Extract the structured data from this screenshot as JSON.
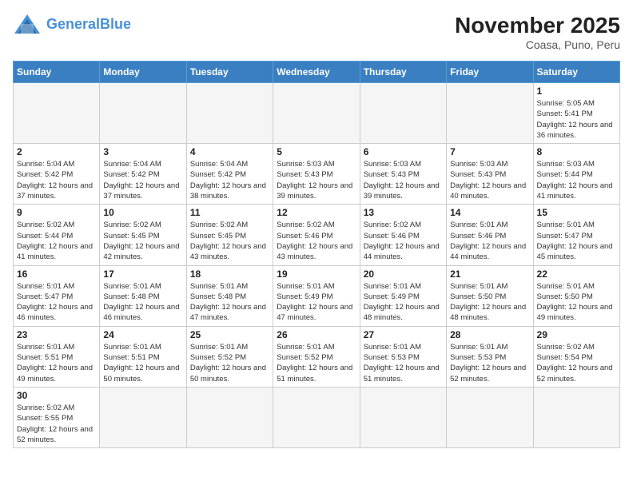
{
  "header": {
    "logo_general": "General",
    "logo_blue": "Blue",
    "month_year": "November 2025",
    "location": "Coasa, Puno, Peru"
  },
  "weekdays": [
    "Sunday",
    "Monday",
    "Tuesday",
    "Wednesday",
    "Thursday",
    "Friday",
    "Saturday"
  ],
  "weeks": [
    [
      {
        "day": "",
        "info": ""
      },
      {
        "day": "",
        "info": ""
      },
      {
        "day": "",
        "info": ""
      },
      {
        "day": "",
        "info": ""
      },
      {
        "day": "",
        "info": ""
      },
      {
        "day": "",
        "info": ""
      },
      {
        "day": "1",
        "info": "Sunrise: 5:05 AM\nSunset: 5:41 PM\nDaylight: 12 hours\nand 36 minutes."
      }
    ],
    [
      {
        "day": "2",
        "info": "Sunrise: 5:04 AM\nSunset: 5:42 PM\nDaylight: 12 hours\nand 37 minutes."
      },
      {
        "day": "3",
        "info": "Sunrise: 5:04 AM\nSunset: 5:42 PM\nDaylight: 12 hours\nand 37 minutes."
      },
      {
        "day": "4",
        "info": "Sunrise: 5:04 AM\nSunset: 5:42 PM\nDaylight: 12 hours\nand 38 minutes."
      },
      {
        "day": "5",
        "info": "Sunrise: 5:03 AM\nSunset: 5:43 PM\nDaylight: 12 hours\nand 39 minutes."
      },
      {
        "day": "6",
        "info": "Sunrise: 5:03 AM\nSunset: 5:43 PM\nDaylight: 12 hours\nand 39 minutes."
      },
      {
        "day": "7",
        "info": "Sunrise: 5:03 AM\nSunset: 5:43 PM\nDaylight: 12 hours\nand 40 minutes."
      },
      {
        "day": "8",
        "info": "Sunrise: 5:03 AM\nSunset: 5:44 PM\nDaylight: 12 hours\nand 41 minutes."
      }
    ],
    [
      {
        "day": "9",
        "info": "Sunrise: 5:02 AM\nSunset: 5:44 PM\nDaylight: 12 hours\nand 41 minutes."
      },
      {
        "day": "10",
        "info": "Sunrise: 5:02 AM\nSunset: 5:45 PM\nDaylight: 12 hours\nand 42 minutes."
      },
      {
        "day": "11",
        "info": "Sunrise: 5:02 AM\nSunset: 5:45 PM\nDaylight: 12 hours\nand 43 minutes."
      },
      {
        "day": "12",
        "info": "Sunrise: 5:02 AM\nSunset: 5:46 PM\nDaylight: 12 hours\nand 43 minutes."
      },
      {
        "day": "13",
        "info": "Sunrise: 5:02 AM\nSunset: 5:46 PM\nDaylight: 12 hours\nand 44 minutes."
      },
      {
        "day": "14",
        "info": "Sunrise: 5:01 AM\nSunset: 5:46 PM\nDaylight: 12 hours\nand 44 minutes."
      },
      {
        "day": "15",
        "info": "Sunrise: 5:01 AM\nSunset: 5:47 PM\nDaylight: 12 hours\nand 45 minutes."
      }
    ],
    [
      {
        "day": "16",
        "info": "Sunrise: 5:01 AM\nSunset: 5:47 PM\nDaylight: 12 hours\nand 46 minutes."
      },
      {
        "day": "17",
        "info": "Sunrise: 5:01 AM\nSunset: 5:48 PM\nDaylight: 12 hours\nand 46 minutes."
      },
      {
        "day": "18",
        "info": "Sunrise: 5:01 AM\nSunset: 5:48 PM\nDaylight: 12 hours\nand 47 minutes."
      },
      {
        "day": "19",
        "info": "Sunrise: 5:01 AM\nSunset: 5:49 PM\nDaylight: 12 hours\nand 47 minutes."
      },
      {
        "day": "20",
        "info": "Sunrise: 5:01 AM\nSunset: 5:49 PM\nDaylight: 12 hours\nand 48 minutes."
      },
      {
        "day": "21",
        "info": "Sunrise: 5:01 AM\nSunset: 5:50 PM\nDaylight: 12 hours\nand 48 minutes."
      },
      {
        "day": "22",
        "info": "Sunrise: 5:01 AM\nSunset: 5:50 PM\nDaylight: 12 hours\nand 49 minutes."
      }
    ],
    [
      {
        "day": "23",
        "info": "Sunrise: 5:01 AM\nSunset: 5:51 PM\nDaylight: 12 hours\nand 49 minutes."
      },
      {
        "day": "24",
        "info": "Sunrise: 5:01 AM\nSunset: 5:51 PM\nDaylight: 12 hours\nand 50 minutes."
      },
      {
        "day": "25",
        "info": "Sunrise: 5:01 AM\nSunset: 5:52 PM\nDaylight: 12 hours\nand 50 minutes."
      },
      {
        "day": "26",
        "info": "Sunrise: 5:01 AM\nSunset: 5:52 PM\nDaylight: 12 hours\nand 51 minutes."
      },
      {
        "day": "27",
        "info": "Sunrise: 5:01 AM\nSunset: 5:53 PM\nDaylight: 12 hours\nand 51 minutes."
      },
      {
        "day": "28",
        "info": "Sunrise: 5:01 AM\nSunset: 5:53 PM\nDaylight: 12 hours\nand 52 minutes."
      },
      {
        "day": "29",
        "info": "Sunrise: 5:02 AM\nSunset: 5:54 PM\nDaylight: 12 hours\nand 52 minutes."
      }
    ],
    [
      {
        "day": "30",
        "info": "Sunrise: 5:02 AM\nSunset: 5:55 PM\nDaylight: 12 hours\nand 52 minutes."
      },
      {
        "day": "",
        "info": ""
      },
      {
        "day": "",
        "info": ""
      },
      {
        "day": "",
        "info": ""
      },
      {
        "day": "",
        "info": ""
      },
      {
        "day": "",
        "info": ""
      },
      {
        "day": "",
        "info": ""
      }
    ]
  ]
}
